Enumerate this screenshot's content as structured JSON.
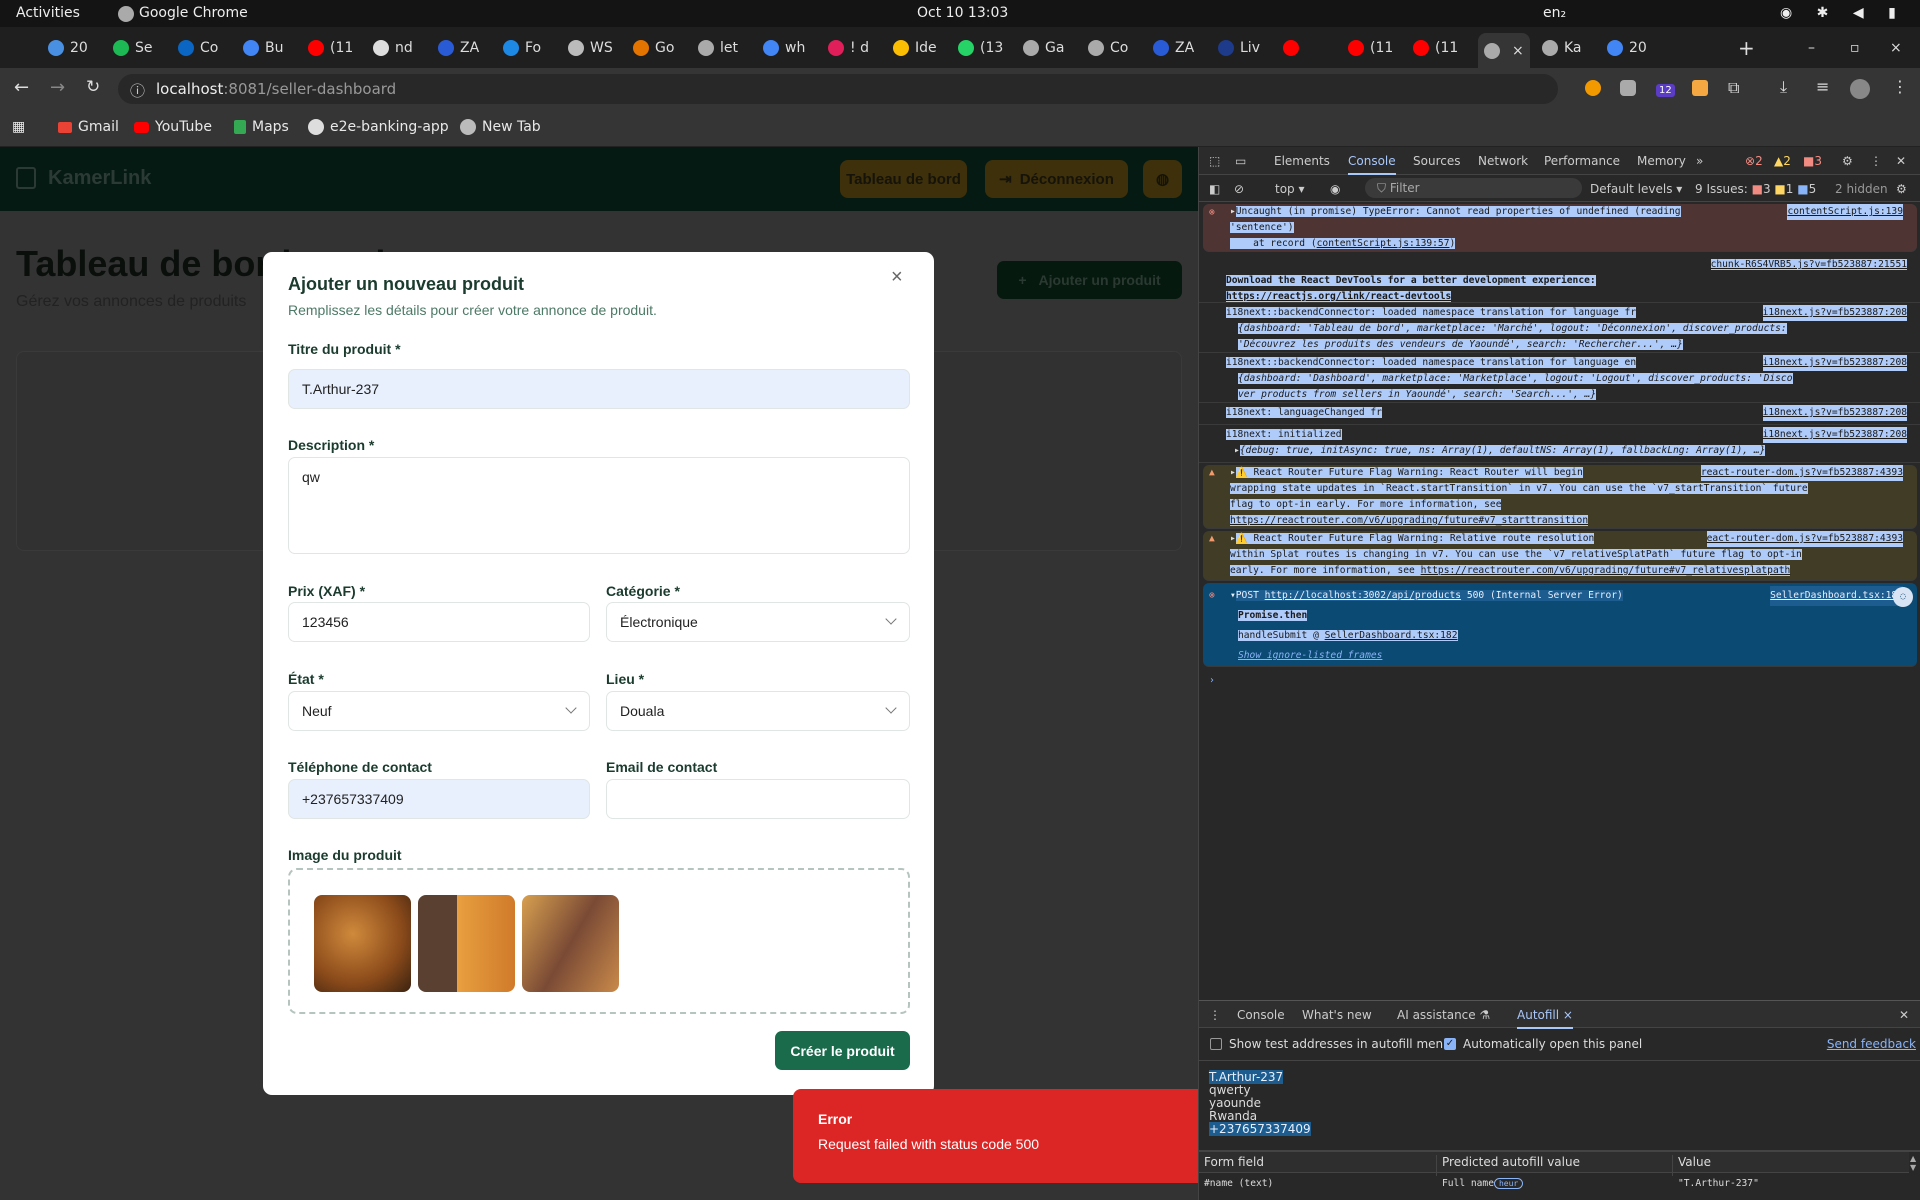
{
  "os": {
    "activities": "Activities",
    "app": "Google Chrome",
    "clock": "Oct 10  13:03",
    "lang": "en₂"
  },
  "tabs": [
    "20",
    "Se",
    "Co",
    "Bu",
    "(11",
    "nd",
    "ZA",
    "Fo",
    "WS",
    "Go",
    "let",
    "wh",
    "! d",
    "Ide",
    "(13",
    "Ga",
    "Co",
    "ZA",
    "Liv",
    "",
    "(11",
    "(11",
    "",
    "Ka",
    "20"
  ],
  "browser": {
    "url_host": "localhost",
    "url_rest": ":8081/seller-dashboard",
    "ext_badge": "12"
  },
  "bookmarks": [
    "Gmail",
    "YouTube",
    "Maps",
    "e2e-banking-app",
    "New Tab"
  ],
  "app": {
    "brand": "KamerLink",
    "nav_dashboard": "Tableau de bord",
    "nav_logout": "Déconnexion",
    "page_title": "Tableau de bord vendeur",
    "page_subtitle": "Gérez vos annonces de produits",
    "add_button": "Ajouter un produit"
  },
  "modal": {
    "title": "Ajouter un nouveau produit",
    "subtitle": "Remplissez les détails pour créer votre annonce de produit.",
    "close": "×",
    "title_label": "Titre du produit *",
    "title_value": "T.Arthur-237",
    "desc_label": "Description *",
    "desc_value": "qw",
    "price_label": "Prix (XAF) *",
    "price_value": "123456",
    "category_label": "Catégorie *",
    "category_value": "Électronique",
    "condition_label": "État *",
    "condition_value": "Neuf",
    "location_label": "Lieu *",
    "location_value": "Douala",
    "phone_label": "Téléphone de contact",
    "phone_value": "+237657337409",
    "email_label": "Email de contact",
    "email_value": "",
    "image_label": "Image du produit",
    "submit": "Créer le produit"
  },
  "toast": {
    "title": "Error",
    "message": "Request failed with status code 500"
  },
  "devtools": {
    "tabs": [
      "Elements",
      "Console",
      "Sources",
      "Network",
      "Performance",
      "Memory",
      "»"
    ],
    "counts": {
      "errors": "2",
      "warnings": "2",
      "issues_flag": "3"
    },
    "context": "top ▾",
    "filter_placeholder": "Filter",
    "levels": "Default levels ▾",
    "issues": "9 Issues:",
    "issue_counts": [
      "3",
      "1",
      "5"
    ],
    "hidden": "2 hidden",
    "messages": {
      "m1a": "Uncaught (in promise) TypeError: Cannot read properties of undefined (reading ",
      "m1src": "contentScript.js:139",
      "m1b": "'sentence')",
      "m1c": "    at record (",
      "m1link": "contentScript.js:139:57",
      "m1d": ")",
      "m2src": "chunk-R6S4VRB5.js?v=fb523887:21551",
      "m2a": "Download the React DevTools for a better development experience:",
      "m2b": "https://reactjs.org/link/react-devtools",
      "m3a": "i18next::backendConnector: loaded namespace translation for language fr",
      "m3src": "i18next.js?v=fb523887:208",
      "m3b": "{dashboard: 'Tableau de bord', marketplace: 'Marché', logout: 'Déconnexion', discover_products:",
      "m3c": "'Découvrez les produits des vendeurs de Yaoundé', search: 'Rechercher...', …}",
      "m4a": "i18next::backendConnector: loaded namespace translation for language en",
      "m4src": "i18next.js?v=fb523887:208",
      "m4b": "{dashboard: 'Dashboard', marketplace: 'Marketplace', logout: 'Logout', discover_products: 'Disco",
      "m4c": "ver products from sellers in Yaoundé', search: 'Search...', …}",
      "m5a": "i18next: languageChanged fr",
      "m5src": "i18next.js?v=fb523887:208",
      "m6a": "i18next: initialized",
      "m6src": "i18next.js?v=fb523887:208",
      "m6b": "{debug: true, initAsync: true, ns: Array(1), defaultNS: Array(1), fallbackLng: Array(1), …}",
      "w1a": "⚠️ React Router Future Flag Warning: React Router will begin",
      "w1src": "react-router-dom.js?v=fb523887:4393",
      "w1b": "wrapping state updates in `React.startTransition` in v7. You can use the `v7_startTransition` future",
      "w1c": "flag to opt-in early. For more information, see",
      "w1d": "https://reactrouter.com/v6/upgrading/future#v7_starttransition",
      "w2a": "⚠️ React Router Future Flag Warning: Relative route resolution",
      "w2src": "eact-router-dom.js?v=fb523887:4393",
      "w2b": "within Splat routes is changing in v7. You can use the `v7_relativeSplatPath` future flag to opt-in",
      "w2c": "early. For more information, see ",
      "w2d": "https://reactrouter.com/v6/upgrading/future#v7_relativesplatpath",
      "e2a": "POST ",
      "e2url": "http://localhost:3002/api/products",
      "e2b": " 500 (Internal Server Error)",
      "e2src": "SellerDashboard.tsx:182",
      "e2c": "Promise.then",
      "e2d": "handleSubmit",
      "e2at": " @ ",
      "e2e": "SellerDashboard.tsx:182",
      "e2f": "Show ignore-listed frames"
    },
    "drawer_tabs": [
      "Console",
      "What's new",
      "AI assistance ⚗",
      "Autofill ×"
    ],
    "autofill": {
      "opt1": "Show test addresses in autofill menu",
      "opt2": "Automatically open this panel",
      "feedback": "Send feedback",
      "address": [
        "T.Arthur-237",
        "qwerty",
        "yaounde",
        "Rwanda",
        "+237657337409"
      ],
      "headers": [
        "Form field",
        "Predicted autofill value",
        "Value"
      ],
      "row": [
        "#name (text)",
        "Full name",
        "heur",
        "\"T.Arthur-237\""
      ]
    }
  }
}
